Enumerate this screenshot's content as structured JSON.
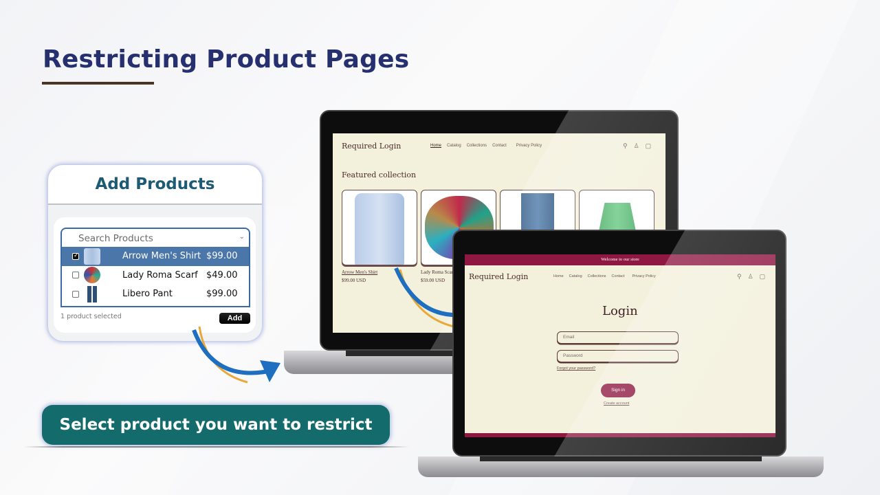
{
  "page": {
    "title": "Restricting Product Pages",
    "banner": "Select product you want to restrict",
    "colors": {
      "title": "#26306f",
      "banner": "#136c6b",
      "selected_row": "#4a76aa",
      "store_accent": "#8e1842",
      "arrow_blue": "#1f6fc1",
      "arrow_gold": "#e8a93a"
    }
  },
  "add_products": {
    "title": "Add Products",
    "search_placeholder": "Search Products",
    "products": [
      {
        "name": "Arrow Men's Shirt",
        "price": "$99.00",
        "checked": true,
        "thumb": "shirt"
      },
      {
        "name": "Lady Roma Scarf",
        "price": "$49.00",
        "checked": false,
        "thumb": "scarf"
      },
      {
        "name": "Libero Pant",
        "price": "$99.00",
        "checked": false,
        "thumb": "pant"
      }
    ],
    "selected_count": "1 product selected",
    "add_label": "Add"
  },
  "store_home": {
    "logo": "Required Login",
    "nav": [
      "Home",
      "Catalog",
      "Collections",
      "Contact",
      "Privacy Policy"
    ],
    "active_nav": "Home",
    "icons": [
      "search-icon",
      "account-icon",
      "cart-icon"
    ],
    "featured_title": "Featured collection",
    "products": [
      {
        "name": "Arrow Men's Shirt",
        "price": "$99.00 USD"
      },
      {
        "name": "Lady Roma Scarf",
        "price": "$59.00 USD"
      },
      {
        "name": "",
        "price": ""
      },
      {
        "name": "",
        "price": ""
      }
    ]
  },
  "store_login": {
    "announcement": "Welcome to our store",
    "logo": "Required Login",
    "nav": [
      "Home",
      "Catalog",
      "Collections",
      "Contact",
      "Privacy Policy"
    ],
    "title": "Login",
    "email_placeholder": "Email",
    "password_placeholder": "Password",
    "forgot": "Forgot your password?",
    "sign_in": "Sign in",
    "create_account": "Create account"
  }
}
